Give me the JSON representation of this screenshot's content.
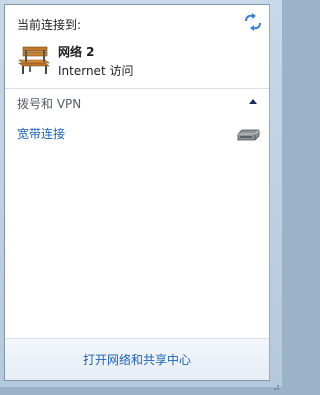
{
  "popup": {
    "header_label": "当前连接到:",
    "refresh_icon": "refresh-arrows-icon",
    "current_network": {
      "icon": "bench-network-icon",
      "name": "网络 2",
      "status": "Internet 访问"
    },
    "group": {
      "title": "拨号和 VPN",
      "state_icon": "collapse-caret-icon",
      "items": [
        {
          "label": "宽带连接",
          "icon": "modem-icon"
        }
      ]
    },
    "footer_link": "打开网络和共享中心"
  },
  "colors": {
    "link": "#1d63b6",
    "text": "#1e1e1e",
    "group_text": "#555c66",
    "panel_border": "#7f96ad",
    "footer_bg": "#eaf0f7"
  }
}
